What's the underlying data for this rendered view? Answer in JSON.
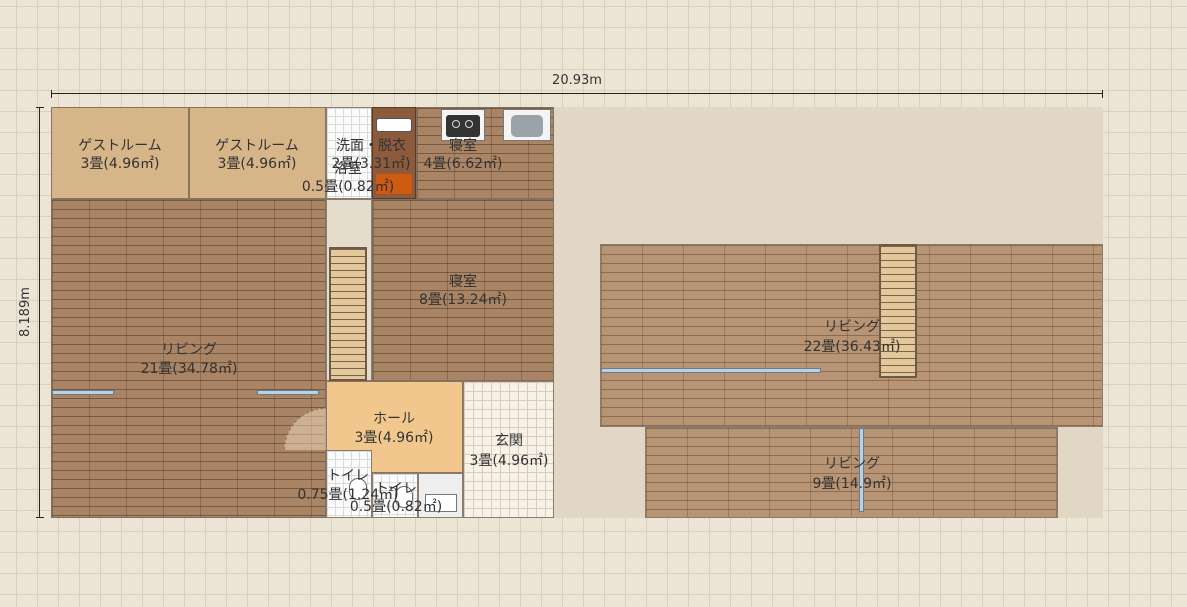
{
  "dimensions": {
    "width": "20.93m",
    "height": "8.189m"
  },
  "rooms": {
    "guest1": {
      "name": "ゲストルーム",
      "size": "3畳(4.96㎡)"
    },
    "guest2": {
      "name": "ゲストルーム",
      "size": "3畳(4.96㎡)"
    },
    "washroom": {
      "name": "洗面・脱衣",
      "size": "2畳(3.31㎡)"
    },
    "bath": {
      "name": "浴室",
      "size": "0.5畳(0.82㎡)"
    },
    "bedroom_small": {
      "name": "寝室",
      "size": "4畳(6.62㎡)"
    },
    "bedroom_large": {
      "name": "寝室",
      "size": "8畳(13.24㎡)"
    },
    "living_main": {
      "name": "リビング",
      "size": "21畳(34.78㎡)"
    },
    "hall": {
      "name": "ホール",
      "size": "3畳(4.96㎡)"
    },
    "entrance": {
      "name": "玄関",
      "size": "3畳(4.96㎡)"
    },
    "toilet1": {
      "name": "トイレ",
      "size": "0.75畳(1.24㎡)"
    },
    "toilet2": {
      "name": "トイレ",
      "size": "0.5畳(0.82㎡)"
    },
    "living_upper": {
      "name": "リビング",
      "size": "22畳(36.43㎡)"
    },
    "living_lower": {
      "name": "リビング",
      "size": "9畳(14.9㎡)"
    }
  },
  "icons": [
    "stove-icon",
    "sink-icon",
    "bathtub-icon",
    "toilet-icon",
    "door-swing-icon",
    "staircase-icon",
    "window-icon"
  ]
}
